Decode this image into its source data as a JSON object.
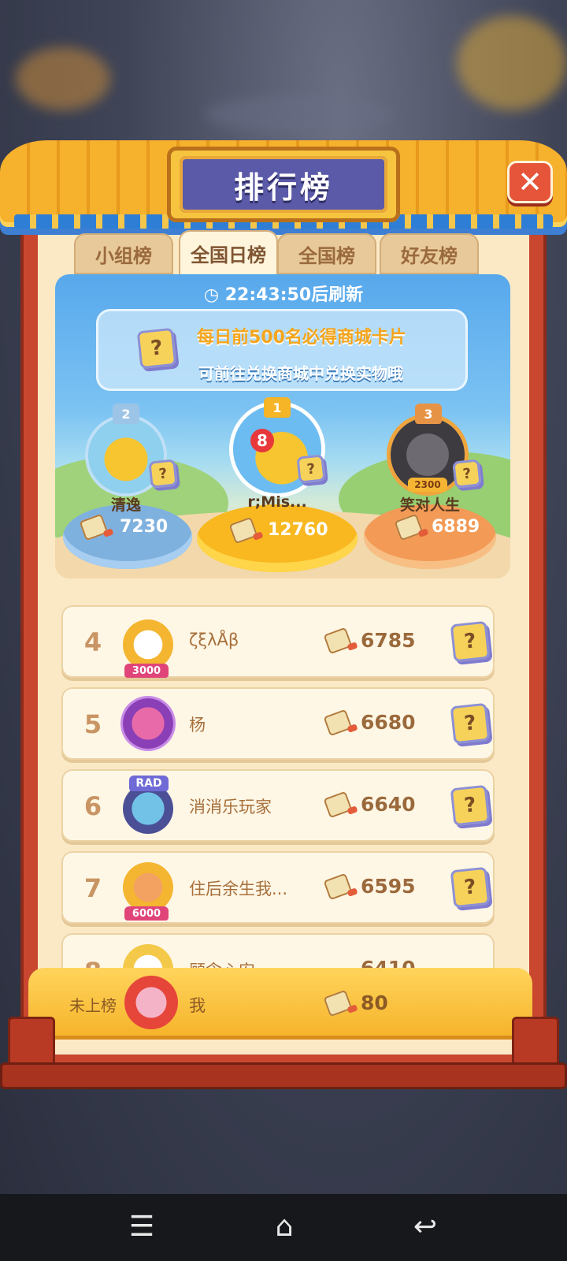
{
  "window": {
    "title": "排行榜",
    "close_label": "✕"
  },
  "tabs": [
    {
      "label": "小组榜",
      "active": false
    },
    {
      "label": "全国日榜",
      "active": true
    },
    {
      "label": "全国榜",
      "active": false
    },
    {
      "label": "好友榜",
      "active": false
    }
  ],
  "board": {
    "timer": "22:43:50后刷新",
    "notice_line1": "每日前500名必得商城卡片",
    "notice_line2": "可前往兑换商城中兑换实物哦"
  },
  "podium": [
    {
      "place": "2",
      "name": "清逸",
      "score": "7230"
    },
    {
      "place": "1",
      "name": "r;Mis...",
      "score": "12760",
      "badge": "8"
    },
    {
      "place": "3",
      "name": "笑对人生",
      "score": "6889",
      "badge": "2300"
    }
  ],
  "rows": [
    {
      "rank": "4",
      "name": "ζξλÅβ",
      "score": "6785",
      "badge": "3000"
    },
    {
      "rank": "5",
      "name": "杨",
      "score": "6680"
    },
    {
      "rank": "6",
      "name": "消消乐玩家",
      "score": "6640",
      "badge": "RAD"
    },
    {
      "rank": "7",
      "name": "住后余生我...",
      "score": "6595",
      "badge": "6000"
    },
    {
      "rank": "8",
      "name": "顾念心安",
      "score": "6410"
    }
  ],
  "me": {
    "rank_label": "未上榜",
    "name": "我",
    "score": "80"
  },
  "card_mark": "?",
  "colors": {
    "gold": "#f6b42b",
    "red_frame": "#c9472f",
    "title_blue": "#5b5aa8"
  },
  "icons": {
    "close": "close-icon",
    "clock": "clock-icon",
    "brush": "brush-icon",
    "card": "mystery-card-icon"
  }
}
